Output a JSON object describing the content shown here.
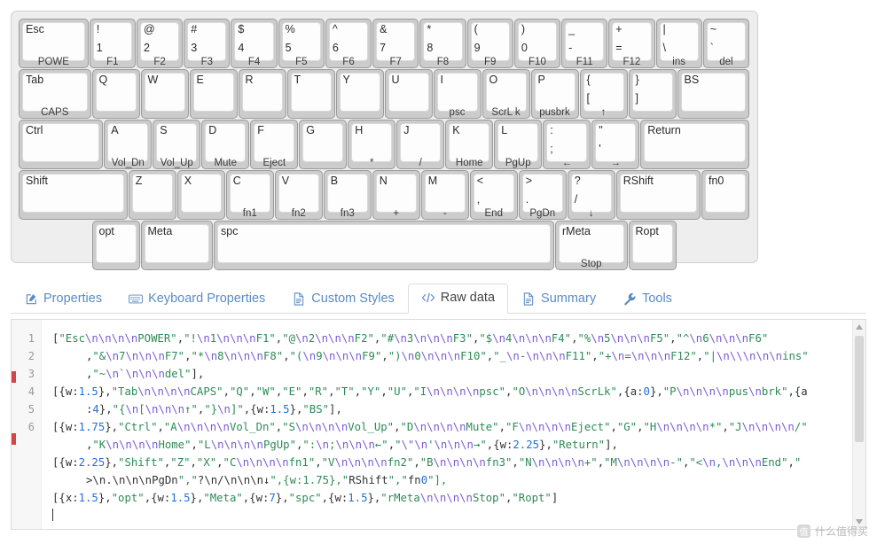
{
  "keyboard": {
    "rows": [
      {
        "keys": [
          {
            "top": "Esc",
            "bottom": "",
            "sub": "POWE",
            "w": 1.5
          },
          {
            "top": "!",
            "bottom": "1",
            "sub": "F1",
            "w": 1
          },
          {
            "top": "@",
            "bottom": "2",
            "sub": "F2",
            "w": 1
          },
          {
            "top": "#",
            "bottom": "3",
            "sub": "F3",
            "w": 1
          },
          {
            "top": "$",
            "bottom": "4",
            "sub": "F4",
            "w": 1
          },
          {
            "top": "%",
            "bottom": "5",
            "sub": "F5",
            "w": 1
          },
          {
            "top": "^",
            "bottom": "6",
            "sub": "F6",
            "w": 1
          },
          {
            "top": "&",
            "bottom": "7",
            "sub": "F7",
            "w": 1
          },
          {
            "top": "*",
            "bottom": "8",
            "sub": "F8",
            "w": 1
          },
          {
            "top": "(",
            "bottom": "9",
            "sub": "F9",
            "w": 1
          },
          {
            "top": ")",
            "bottom": "0",
            "sub": "F10",
            "w": 1
          },
          {
            "top": "_",
            "bottom": "-",
            "sub": "F11",
            "w": 1
          },
          {
            "top": "+",
            "bottom": "=",
            "sub": "F12",
            "w": 1
          },
          {
            "top": "|",
            "bottom": "\\",
            "sub": "ins",
            "w": 1
          },
          {
            "top": "~",
            "bottom": "`",
            "sub": "del",
            "w": 1
          }
        ]
      },
      {
        "keys": [
          {
            "top": "Tab",
            "bottom": "",
            "sub": "CAPS",
            "w": 1.5
          },
          {
            "top": "Q",
            "bottom": "",
            "sub": "",
            "w": 1
          },
          {
            "top": "W",
            "bottom": "",
            "sub": "",
            "w": 1
          },
          {
            "top": "E",
            "bottom": "",
            "sub": "",
            "w": 1
          },
          {
            "top": "R",
            "bottom": "",
            "sub": "",
            "w": 1
          },
          {
            "top": "T",
            "bottom": "",
            "sub": "",
            "w": 1
          },
          {
            "top": "Y",
            "bottom": "",
            "sub": "",
            "w": 1
          },
          {
            "top": "U",
            "bottom": "",
            "sub": "",
            "w": 1
          },
          {
            "top": "I",
            "bottom": "",
            "sub": "psc",
            "w": 1
          },
          {
            "top": "O",
            "bottom": "",
            "sub": "ScrL k",
            "w": 1
          },
          {
            "top": "P",
            "bottom": "",
            "sub": "pusbrk",
            "w": 1
          },
          {
            "top": "{",
            "bottom": "[",
            "sub": "↑",
            "w": 1
          },
          {
            "top": "}",
            "bottom": "]",
            "sub": "",
            "w": 1
          },
          {
            "top": "BS",
            "bottom": "",
            "sub": "",
            "w": 1.5
          }
        ]
      },
      {
        "keys": [
          {
            "top": "Ctrl",
            "bottom": "",
            "sub": "",
            "w": 1.75
          },
          {
            "top": "A",
            "bottom": "",
            "sub": "Vol_Dn",
            "w": 1
          },
          {
            "top": "S",
            "bottom": "",
            "sub": "Vol_Up",
            "w": 1
          },
          {
            "top": "D",
            "bottom": "",
            "sub": "Mute",
            "w": 1
          },
          {
            "top": "F",
            "bottom": "",
            "sub": "Eject",
            "w": 1
          },
          {
            "top": "G",
            "bottom": "",
            "sub": "",
            "w": 1
          },
          {
            "top": "H",
            "bottom": "",
            "sub": "*",
            "w": 1
          },
          {
            "top": "J",
            "bottom": "",
            "sub": "/",
            "w": 1
          },
          {
            "top": "K",
            "bottom": "",
            "sub": "Home",
            "w": 1
          },
          {
            "top": "L",
            "bottom": "",
            "sub": "PgUp",
            "w": 1
          },
          {
            "top": ":",
            "bottom": ";",
            "sub": "←",
            "w": 1
          },
          {
            "top": "\"",
            "bottom": "'",
            "sub": "→",
            "w": 1
          },
          {
            "top": "Return",
            "bottom": "",
            "sub": "",
            "w": 2.25
          }
        ]
      },
      {
        "keys": [
          {
            "top": "Shift",
            "bottom": "",
            "sub": "",
            "w": 2.25
          },
          {
            "top": "Z",
            "bottom": "",
            "sub": "",
            "w": 1
          },
          {
            "top": "X",
            "bottom": "",
            "sub": "",
            "w": 1
          },
          {
            "top": "C",
            "bottom": "",
            "sub": "fn1",
            "w": 1
          },
          {
            "top": "V",
            "bottom": "",
            "sub": "fn2",
            "w": 1
          },
          {
            "top": "B",
            "bottom": "",
            "sub": "fn3",
            "w": 1
          },
          {
            "top": "N",
            "bottom": "",
            "sub": "+",
            "w": 1
          },
          {
            "top": "M",
            "bottom": "",
            "sub": "-",
            "w": 1
          },
          {
            "top": "<",
            "bottom": ",",
            "sub": "End",
            "w": 1
          },
          {
            "top": ">",
            "bottom": ".",
            "sub": "PgDn",
            "w": 1
          },
          {
            "top": "?",
            "bottom": "/",
            "sub": "↓",
            "w": 1
          },
          {
            "top": "RShift",
            "bottom": "",
            "sub": "",
            "w": 1.75
          },
          {
            "top": "fn0",
            "bottom": "",
            "sub": "",
            "w": 1
          }
        ]
      },
      {
        "offset": 1.5,
        "keys": [
          {
            "top": "opt",
            "bottom": "",
            "sub": "",
            "w": 1
          },
          {
            "top": "Meta",
            "bottom": "",
            "sub": "",
            "w": 1.5
          },
          {
            "top": "spc",
            "bottom": "",
            "sub": "",
            "w": 7
          },
          {
            "top": "rMeta",
            "bottom": "",
            "sub": "Stop",
            "w": 1.5
          },
          {
            "top": "Ropt",
            "bottom": "",
            "sub": "",
            "w": 1
          }
        ]
      }
    ]
  },
  "tabs": [
    {
      "label": "Properties",
      "icon": "edit-square-icon",
      "active": false
    },
    {
      "label": "Keyboard Properties",
      "icon": "keyboard-icon",
      "active": false
    },
    {
      "label": "Custom Styles",
      "icon": "document-icon",
      "active": false
    },
    {
      "label": "Raw data",
      "icon": "code-icon",
      "active": true
    },
    {
      "label": "Summary",
      "icon": "document-icon",
      "active": false
    },
    {
      "label": "Tools",
      "icon": "wrench-icon",
      "active": false
    }
  ],
  "editor": {
    "line_numbers": [
      "1",
      "2",
      "3",
      "4",
      "5",
      "6"
    ],
    "lines": [
      {
        "number": "1",
        "segments": [
          "[\"Esc\\n\\n\\n\\nPOWER\",\"!\\n1\\n\\n\\nF1\",\"@\\n2\\n\\n\\nF2\",\"#\\n3\\n\\n\\nF3\",\"$\\n4\\n\\n\\nF4\",\"%\\n5\\n\\n\\nF5\",\"^\\n6\\n\\n\\nF6\"",
          ",\"&\\n7\\n\\n\\nF7\",\"*\\n8\\n\\n\\nF8\",\"(\\n9\\n\\n\\nF9\",\")\\n0\\n\\n\\nF10\",\"_\\n-\\n\\n\\nF11\",\"+\\n=\\n\\n\\nF12\",\"|\\n\\\\\\n\\n\\nins\"",
          ",\"~\\n`\\n\\n\\ndel\"],"
        ]
      },
      {
        "number": "2",
        "segments": [
          "[{w:1.5},\"Tab\\n\\n\\n\\nCAPS\",\"Q\",\"W\",\"E\",\"R\",\"T\",\"Y\",\"U\",\"I\\n\\n\\n\\npsc\",\"O\\n\\n\\n\\nScrLk\",{a:0},\"P\\n\\n\\n\\npus\\nbrk\",{a",
          ":4},\"{\\n[\\n\\n\\n↑\",\"}\\n]\",{w:1.5},\"BS\"],"
        ]
      },
      {
        "number": "3",
        "segments": [
          "[{w:1.75},\"Ctrl\",\"A\\n\\n\\n\\nVol_Dn\",\"S\\n\\n\\n\\nVol_Up\",\"D\\n\\n\\n\\nMute\",\"F\\n\\n\\n\\nEject\",\"G\",\"H\\n\\n\\n\\n*\",\"J\\n\\n\\n\\n/\"",
          ",\"K\\n\\n\\n\\nHome\",\"L\\n\\n\\n\\nPgUp\",\":\\n;\\n\\n\\n←\",\"\\\"\\n'\\n\\n\\n→\",{w:2.25},\"Return\"],"
        ]
      },
      {
        "number": "4",
        "segments": [
          "[{w:2.25},\"Shift\",\"Z\",\"X\",\"C\\n\\n\\n\\nfn1\",\"V\\n\\n\\n\\nfn2\",\"B\\n\\n\\n\\nfn3\",\"N\\n\\n\\n\\n+\",\"M\\n\\n\\n\\n-\",\"<\\n,\\n\\n\\nEnd\",\"",
          ">\\n.\\n\\n\\nPgDn\",\"?\\n/\\n\\n\\n↓\",{w:1.75},\"RShift\",\"fn0\"],"
        ]
      },
      {
        "number": "5",
        "segments": [
          "[{x:1.5},\"opt\",{w:1.5},\"Meta\",{w:7},\"spc\",{w:1.5},\"rMeta\\n\\n\\n\\nStop\",\"Ropt\"]"
        ]
      },
      {
        "number": "6",
        "segments": [
          ""
        ]
      }
    ]
  },
  "watermark": {
    "text": "什么值得买",
    "badge": "值"
  },
  "colors": {
    "tab_link": "#5b8bc4",
    "string": "#2e8b57",
    "escape": "#7a5cd6",
    "number": "#1e6fd9",
    "key_face": "#fdfdfd",
    "key_body": "#cccccc",
    "panel_bg": "#eeeeee"
  }
}
